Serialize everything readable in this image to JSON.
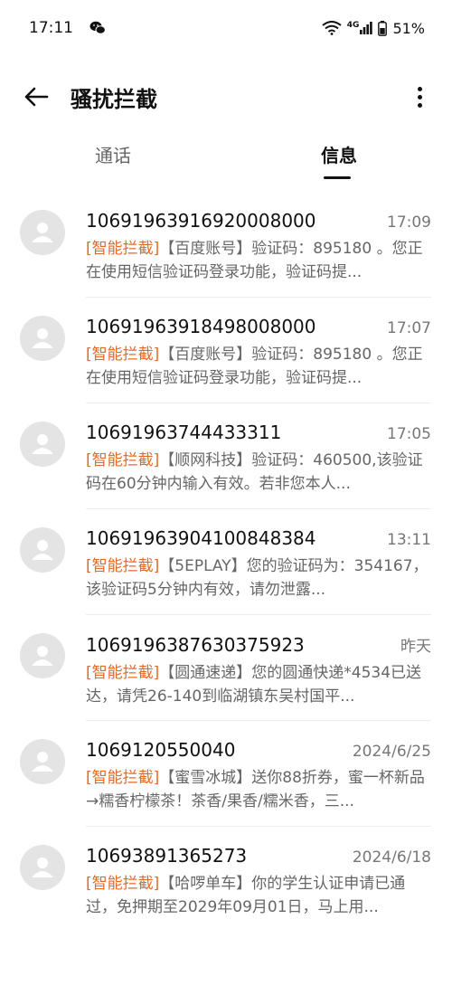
{
  "status_bar": {
    "time": "17:11",
    "network": "4G",
    "battery": "51%"
  },
  "header": {
    "title": "骚扰拦截"
  },
  "tabs": [
    {
      "label": "通话",
      "active": false
    },
    {
      "label": "信息",
      "active": true
    }
  ],
  "colors": {
    "tag": "#e06c2a",
    "avatar_bg": "#e4e4e4"
  },
  "messages": [
    {
      "sender": "1069196391692000 8000",
      "time": "17:09",
      "tag": "[智能拦截]",
      "preview": "【百度账号】验证码：895180 。您正在使用短信验证码登录功能，验证码提..."
    },
    {
      "sender": "1069196391849800 8000",
      "time": "17:07",
      "tag": "[智能拦截]",
      "preview": "【百度账号】验证码：895180 。您正在使用短信验证码登录功能，验证码提..."
    },
    {
      "sender": "10691963744433311",
      "time": "17:05",
      "tag": "[智能拦截]",
      "preview": "【顺网科技】验证码：460500,该验证码在60分钟内输入有效。若非您本人..."
    },
    {
      "sender": "10691963904100848384",
      "time": "13:11",
      "tag": "[智能拦截]",
      "preview": "【5EPLAY】您的验证码为：354167，该验证码5分钟内有效，请勿泄露..."
    },
    {
      "sender": "10691963876303759 23",
      "time": "昨天",
      "tag": "[智能拦截]",
      "preview": "【圆通速递】您的圆通快递*4534已送达，请凭26-140到临湖镇东吴村国平..."
    },
    {
      "sender": "1069120550040",
      "time": "2024/6/25",
      "tag": "[智能拦截]",
      "preview": "【蜜雪冰城】送你88折券，蜜一杯新品→糯香柠檬茶！茶香/果香/糯米香，三..."
    },
    {
      "sender": "10693891365273",
      "time": "2024/6/18",
      "tag": "[智能拦截]",
      "preview": "【哈啰单车】你的学生认证申请已通过，免押期至2029年09月01日，马上用..."
    }
  ]
}
